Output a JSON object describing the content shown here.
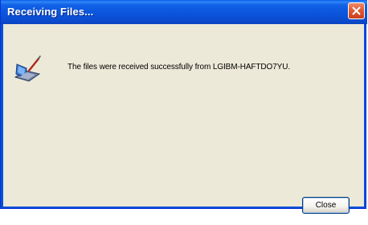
{
  "window": {
    "title": "Receiving Files...",
    "close_icon": "close-icon"
  },
  "dialog": {
    "icon": "laptop-receive-icon",
    "message": "The files were received successfully from LGIBM-HAFTDO7YU."
  },
  "buttons": {
    "close_label": "Close"
  },
  "colors": {
    "titlebar": "#0a55dc",
    "client_bg": "#ece9d8",
    "close_button": "#e05a33"
  }
}
